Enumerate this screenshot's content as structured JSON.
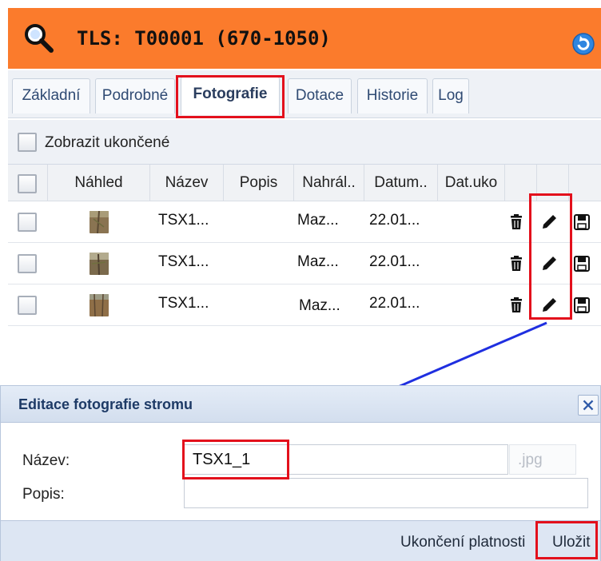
{
  "header": {
    "title": "TLS: T00001 (670-1050)",
    "search_icon": "search-icon",
    "refresh_icon": "refresh-icon",
    "bar_color": "#fb7b2c"
  },
  "tabs": [
    {
      "label": "Základní",
      "active": false
    },
    {
      "label": "Podrobné",
      "active": false
    },
    {
      "label": "Fotografie",
      "active": true
    },
    {
      "label": "Dotace",
      "active": false
    },
    {
      "label": "Historie",
      "active": false
    },
    {
      "label": "Log",
      "active": false
    }
  ],
  "filter": {
    "show_ended_label": "Zobrazit ukončené",
    "checked": false
  },
  "grid": {
    "columns": [
      "Náhled",
      "Název",
      "Popis",
      "Nahrál..",
      "Datum..",
      "Dat.uko"
    ],
    "rows": [
      {
        "name": "TSX1...",
        "description": "",
        "uploaded_by": "Maz...",
        "date": "22.01...",
        "end_date": ""
      },
      {
        "name": "TSX1...",
        "description": "",
        "uploaded_by": "Maz...",
        "date": "22.01...",
        "end_date": ""
      },
      {
        "name": "TSX1...",
        "description": "",
        "uploaded_by": "Maz...",
        "date": "22.01...",
        "end_date": ""
      }
    ],
    "row_actions": [
      "trash-icon",
      "pencil-icon",
      "save-icon"
    ]
  },
  "dialog": {
    "title": "Editace fotografie stromu",
    "name_label": "Název:",
    "name_value": "TSX1_1",
    "suffix": ".jpg",
    "description_label": "Popis:",
    "description_value": "",
    "end_validity_label": "Ukončení platnosti",
    "save_label": "Uložit"
  },
  "highlight_color": "#e3101c",
  "arrow_color": "#1f2fe0"
}
